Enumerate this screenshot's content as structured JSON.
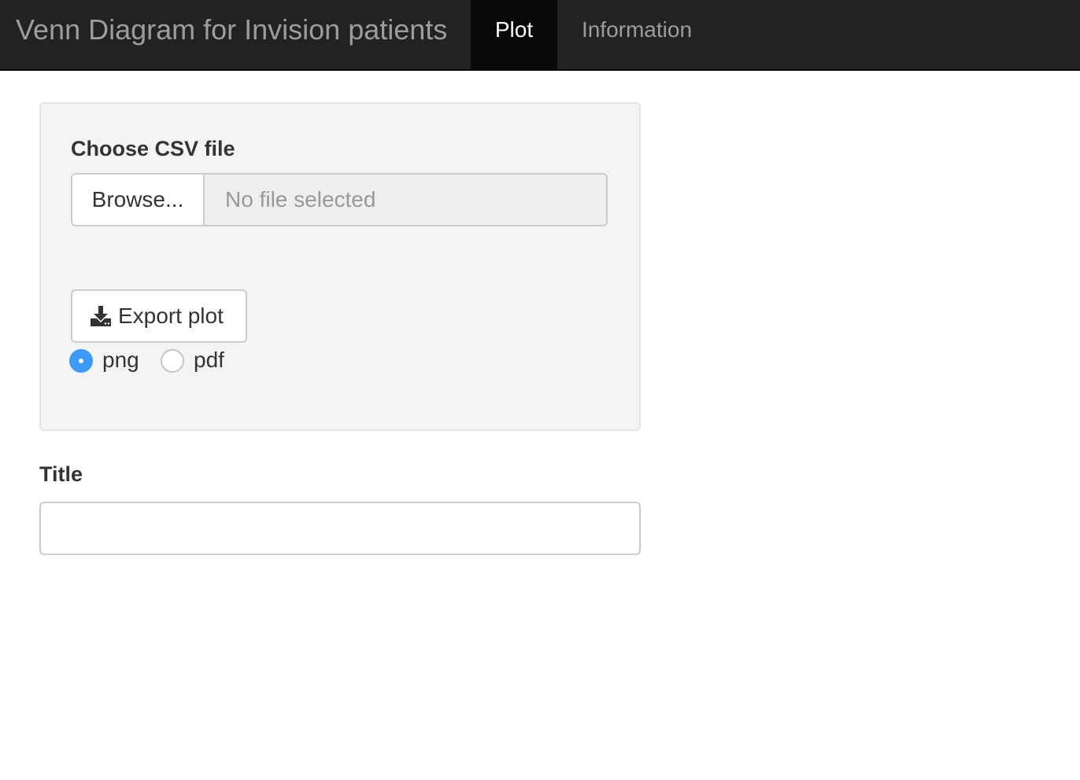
{
  "navbar": {
    "brand": "Venn Diagram for Invision patients",
    "tabs": [
      {
        "label": "Plot",
        "active": true
      },
      {
        "label": "Information",
        "active": false
      }
    ]
  },
  "sidebar": {
    "file_input": {
      "label": "Choose CSV file",
      "browse_label": "Browse...",
      "status_text": "No file selected"
    },
    "export": {
      "button_label": "Export plot",
      "icon": "download-icon",
      "formats": [
        {
          "label": "png",
          "selected": true
        },
        {
          "label": "pdf",
          "selected": false
        }
      ]
    }
  },
  "title_field": {
    "label": "Title",
    "value": ""
  },
  "colors": {
    "navbar_bg": "#222222",
    "active_tab_bg": "#080808",
    "radio_accent": "#3f9af7",
    "well_bg": "#f4f4f4"
  }
}
